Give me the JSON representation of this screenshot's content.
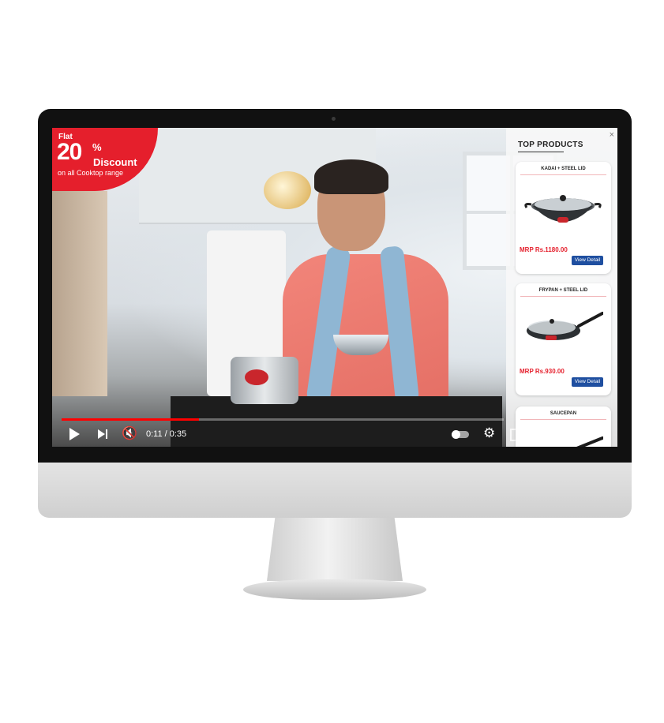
{
  "badge": {
    "flat": "Flat",
    "number": "20",
    "percent": "%",
    "word": "Discount",
    "subtitle": "on all Cooktop range"
  },
  "player": {
    "time": "0:11 / 0:35",
    "progress_fraction": 0.31
  },
  "panel": {
    "title": "TOP PRODUCTS",
    "close_symbol": "×",
    "products": [
      {
        "name": "KADAI + STEEL LID",
        "price": "MRP Rs.1180.00",
        "button": "View Detail"
      },
      {
        "name": "FRYPAN + STEEL LID",
        "price": "MRP Rs.930.00",
        "button": "View Detail"
      },
      {
        "name": "SAUCEPAN"
      }
    ]
  },
  "icons": [
    "play-icon",
    "next-icon",
    "mute-icon",
    "autoplay-toggle-icon",
    "gear-icon",
    "theater-icon",
    "close-icon"
  ],
  "colors": {
    "accent_red": "#e51f2c",
    "button_blue": "#1f4fa0",
    "progress_red": "#ff0000"
  }
}
